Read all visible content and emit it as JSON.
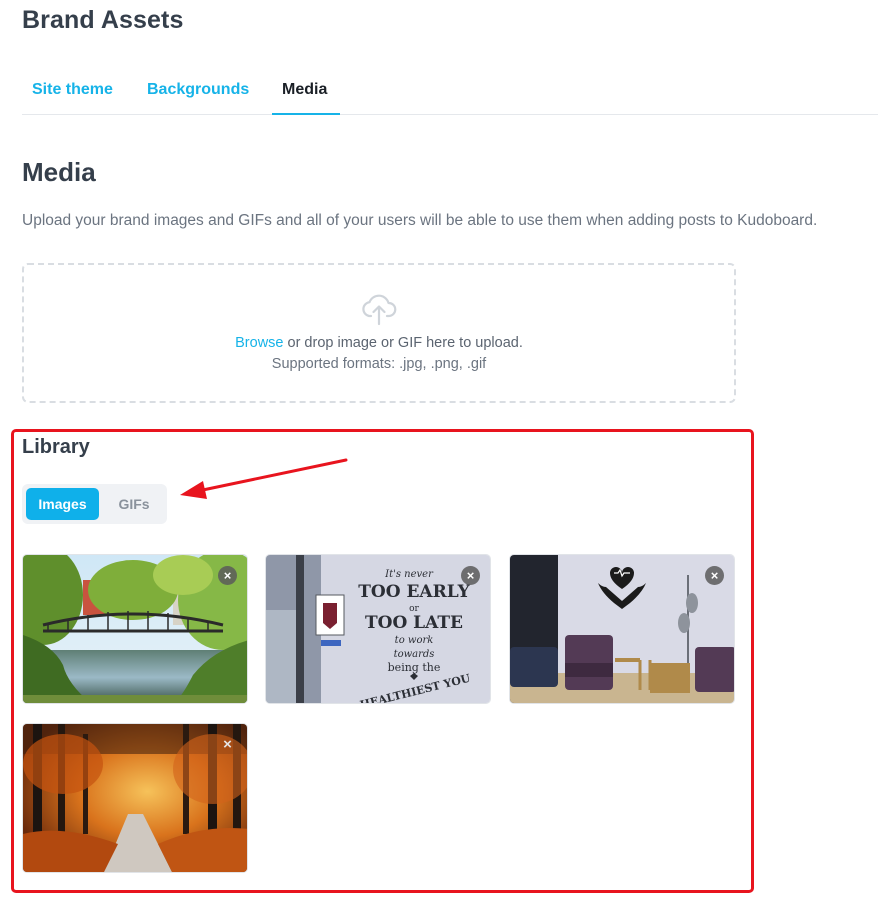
{
  "page": {
    "title": "Brand Assets"
  },
  "tabs": [
    {
      "label": "Site theme"
    },
    {
      "label": "Backgrounds"
    },
    {
      "label": "Media"
    }
  ],
  "active_tab": "Media",
  "accent_color": "#16b3e8",
  "annotation_color": "#e8141e",
  "media": {
    "title": "Media",
    "description": "Upload your brand images and GIFs and all of your users will be able to use them when adding posts to Kudoboard."
  },
  "upload": {
    "icon": "cloud-upload-icon",
    "browse_label": "Browse",
    "instruction": " or drop image or GIF here to upload.",
    "formats": "Supported formats: .jpg, .png, .gif"
  },
  "library": {
    "title": "Library",
    "toggle": {
      "images_label": "Images",
      "gifs_label": "GIFs",
      "selected": "Images"
    },
    "items": [
      {
        "subject": "river-bridge",
        "remove_icon": "close-icon"
      },
      {
        "subject": "wall-quote",
        "quote_lines": [
          "It's never",
          "TOO EARLY",
          "or",
          "TOO LATE",
          "to work",
          "towards",
          "being the",
          "HEALTHIEST YOU"
        ],
        "remove_icon": "close-icon"
      },
      {
        "subject": "waiting-room",
        "remove_icon": "close-icon"
      },
      {
        "subject": "autumn-path",
        "remove_icon": "close-icon"
      }
    ],
    "remove_glyph": "×"
  }
}
